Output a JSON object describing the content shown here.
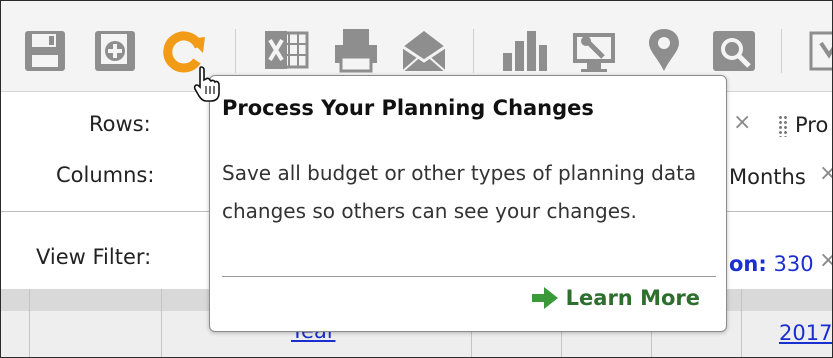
{
  "toolbar": {
    "icons": [
      {
        "name": "save-icon"
      },
      {
        "name": "save-as-icon"
      },
      {
        "name": "process-changes-icon",
        "color": "#f29b17"
      },
      {
        "name": "excel-export-icon"
      },
      {
        "name": "print-icon"
      },
      {
        "name": "email-icon"
      },
      {
        "name": "chart-icon"
      },
      {
        "name": "analyze-icon"
      },
      {
        "name": "map-pin-icon"
      },
      {
        "name": "zoom-icon"
      },
      {
        "name": "more-icon"
      }
    ]
  },
  "pivot": {
    "rows_label": "Rows:",
    "columns_label": "Columns:",
    "view_filter_label": "View Filter:",
    "rows_chip_partial": "Pro",
    "columns_chip": "Months",
    "filter_key_partial": "on:",
    "filter_value": "330"
  },
  "grid": {
    "year_link_partial": "Year",
    "year_value": "2017"
  },
  "tooltip": {
    "title": "Process Your Planning Changes",
    "body": "Save all budget or other types of planning data changes so others can see your changes.",
    "link_label": "Learn More"
  },
  "colors": {
    "icon_gray": "#8e8e8e",
    "accent_orange": "#f29b17",
    "link_blue": "#1a2fcf",
    "learn_more_green": "#2e6e2e",
    "arrow_green": "#3a9a3a"
  }
}
